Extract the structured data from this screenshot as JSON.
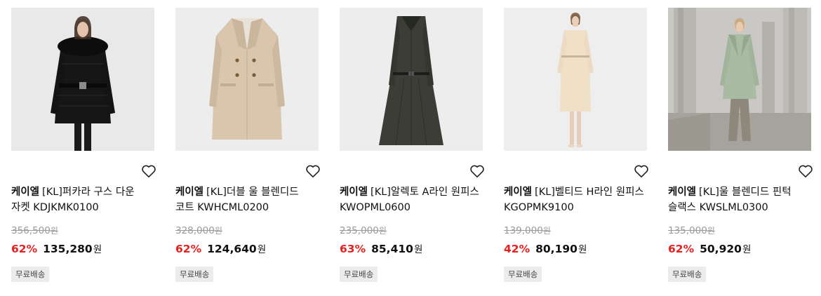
{
  "products": [
    {
      "brand": "케이엘",
      "name": "[KL]퍼카라 구스 다운 자켓 KDJKMK0100",
      "original_price": "356,500",
      "discount_rate": "62%",
      "sale_price": "135,280",
      "currency": "원",
      "badge": "무료배송",
      "image_desc": "model-black-down-jacket"
    },
    {
      "brand": "케이엘",
      "name": "[KL]더블 울 블렌디드 코트 KWHCML0200",
      "original_price": "328,000",
      "discount_rate": "62%",
      "sale_price": "124,640",
      "currency": "원",
      "badge": "무료배송",
      "image_desc": "beige-double-coat"
    },
    {
      "brand": "케이엘",
      "name": "[KL]알렉토 A라인 원피스 KWOPML0600",
      "original_price": "235,000",
      "discount_rate": "63%",
      "sale_price": "85,410",
      "currency": "원",
      "badge": "무료배송",
      "image_desc": "dark-green-a-line-dress"
    },
    {
      "brand": "케이엘",
      "name": "[KL]벨티드 H라인 원피스 KGOPMK9100",
      "original_price": "139,000",
      "discount_rate": "42%",
      "sale_price": "80,190",
      "currency": "원",
      "badge": "무료배송",
      "image_desc": "model-cream-h-line-dress"
    },
    {
      "brand": "케이엘",
      "name": "[KL]울 블렌디드 핀턱 슬랙스 KWSLML0300",
      "original_price": "135,000",
      "discount_rate": "62%",
      "sale_price": "50,920",
      "currency": "원",
      "badge": "무료배송",
      "image_desc": "model-mint-coat-slacks-columns"
    }
  ],
  "colors": {
    "discount": "#e52222",
    "badge_bg": "#ececec",
    "strike_text": "#9a9a9a"
  },
  "icons": {
    "wishlist": "heart-outline-icon"
  }
}
